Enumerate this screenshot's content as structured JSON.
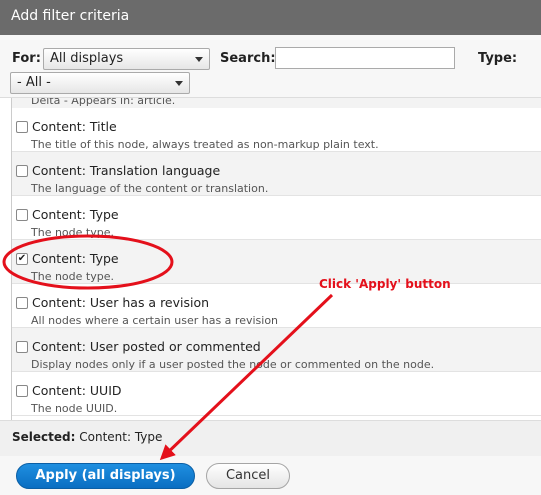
{
  "dialog": {
    "title": "Add filter criteria"
  },
  "filters": {
    "for_label": "For:",
    "for_value": "All displays",
    "search_label": "Search:",
    "search_value": "",
    "type_label": "Type:",
    "type_value": "- All -"
  },
  "list": {
    "partial_desc": "Delta - Appears in: article.",
    "items": [
      {
        "title": "Content: Title",
        "desc": "The title of this node, always treated as non-markup plain text.",
        "checked": false
      },
      {
        "title": "Content: Translation language",
        "desc": "The language of the content or translation.",
        "checked": false
      },
      {
        "title": "Content: Type",
        "desc": "The node type.",
        "checked": false
      },
      {
        "title": "Content: Type",
        "desc": "The node type.",
        "checked": true
      },
      {
        "title": "Content: User has a revision",
        "desc": "All nodes where a certain user has a revision",
        "checked": false
      },
      {
        "title": "Content: User posted or commented",
        "desc": "Display nodes only if a user posted the node or commented on the node.",
        "checked": false
      },
      {
        "title": "Content: UUID",
        "desc": "The node UUID.",
        "checked": false
      }
    ]
  },
  "selected": {
    "label": "Selected:",
    "value": "Content: Type"
  },
  "buttons": {
    "apply": "Apply (all displays)",
    "cancel": "Cancel"
  },
  "annotation": {
    "text": "Click 'Apply' button",
    "color": "#e4101b"
  },
  "icons": {
    "checkbox_checked": "✔",
    "dropdown": "caret-down"
  }
}
